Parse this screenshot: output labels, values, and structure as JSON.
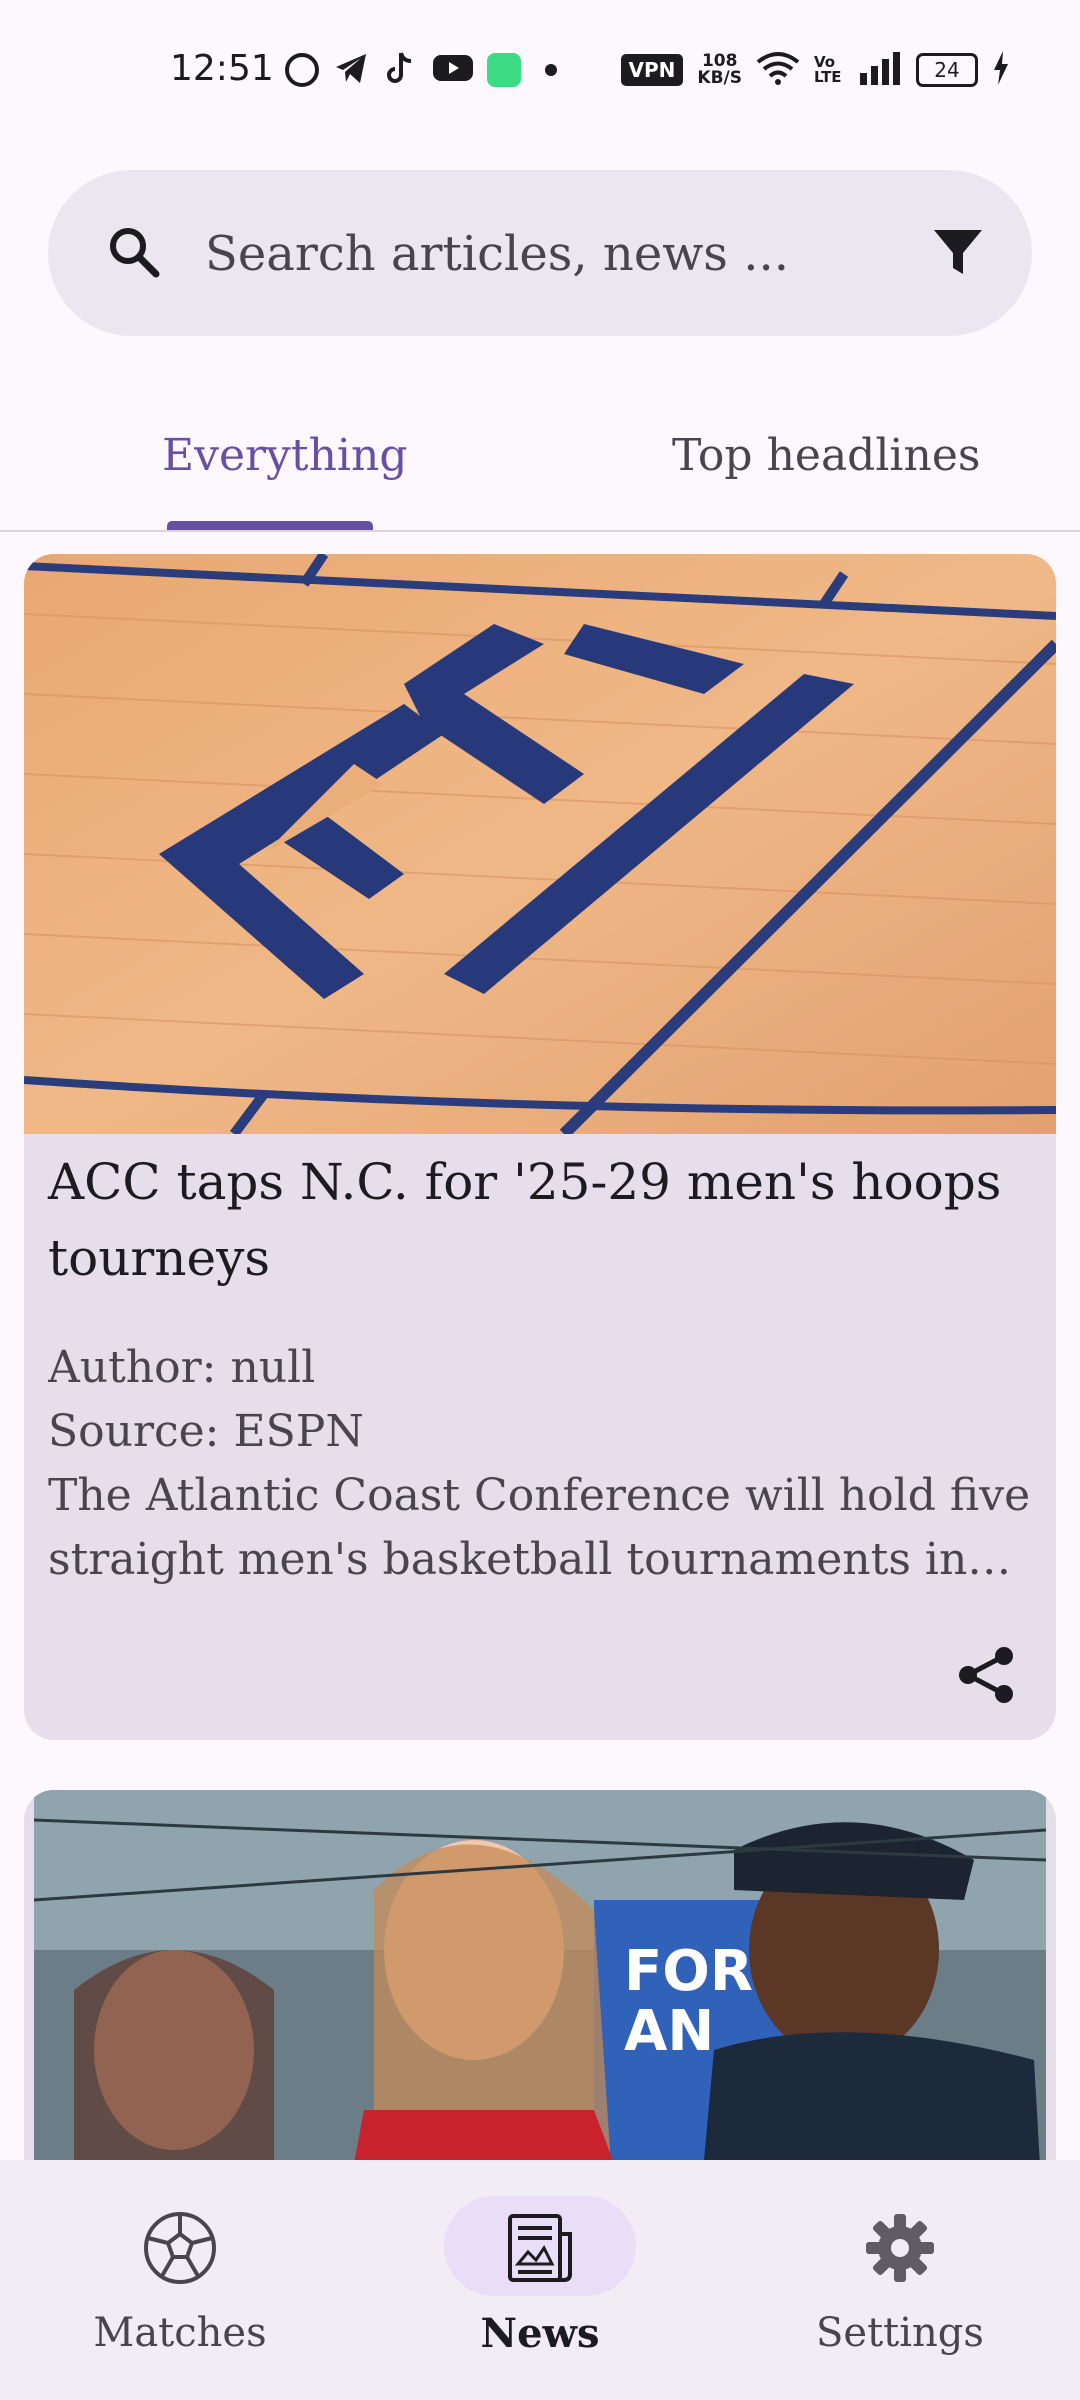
{
  "status_bar": {
    "time": "12:51",
    "vpn": "VPN",
    "network_speed": "108",
    "network_unit": "KB/S",
    "volte": "Vo LTE",
    "battery": "24"
  },
  "search": {
    "placeholder": "Search articles, news ...",
    "search_icon": "search-icon",
    "filter_icon": "filter-icon"
  },
  "tabs": [
    {
      "label": "Everything",
      "selected": true
    },
    {
      "label": "Top headlines",
      "selected": false
    }
  ],
  "articles": [
    {
      "title": "ACC taps N.C. for '25-29 men's hoops tourneys",
      "author": "Author: null",
      "source": "Source: ESPN",
      "description": "The Atlantic Coast Conference will hold five straight men's basketball tournaments in North Carolina",
      "image": "basketball-court-acc-logo",
      "share_icon": "share-icon"
    },
    {
      "image": "crowd-photo"
    }
  ],
  "bottom_nav": [
    {
      "label": "Matches",
      "icon": "soccer-ball-icon",
      "selected": false
    },
    {
      "label": "News",
      "icon": "newspaper-icon",
      "selected": true
    },
    {
      "label": "Settings",
      "icon": "gear-icon",
      "selected": false
    }
  ],
  "colors": {
    "background": "#fdf8fd",
    "accent": "#6750a4",
    "card": "#e6dfeb",
    "search_bg": "#ece6f0",
    "nav_bg": "#f2ecf4",
    "nav_pill": "#e8def8"
  }
}
